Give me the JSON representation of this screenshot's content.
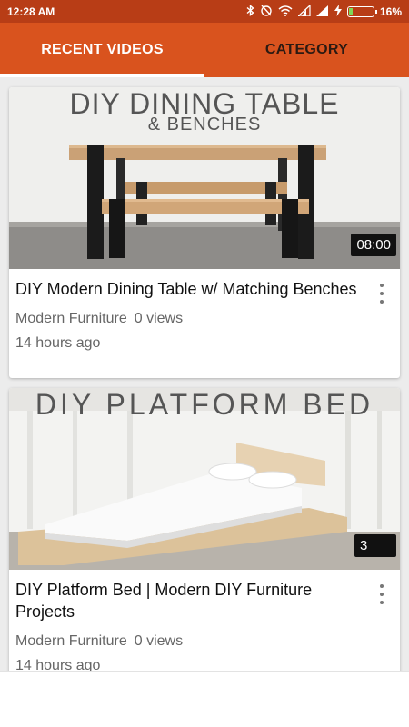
{
  "status_bar": {
    "time": "12:28 AM",
    "battery_percent": "16%",
    "battery_level": 0.16,
    "icons": [
      "bluetooth-icon",
      "alarm-icon",
      "wifi-icon",
      "signal-icon",
      "signal-icon",
      "charging-icon"
    ]
  },
  "tabs": [
    {
      "label": "RECENT VIDEOS",
      "active": true
    },
    {
      "label": "CATEGORY",
      "active": false
    }
  ],
  "videos": [
    {
      "thumbnail_text": "DIY DINING TABLE",
      "thumbnail_subtext": "& BENCHES",
      "duration": "08:00",
      "title": "DIY Modern Dining Table w/ Matching Benches",
      "channel": "Modern Furniture",
      "views": "0 views",
      "time_ago": "14 hours ago"
    },
    {
      "thumbnail_text": "DIY PLATFORM BED",
      "duration": "3",
      "title": "DIY Platform Bed | Modern DIY Furniture Projects",
      "channel": "Modern Furniture",
      "views": "0 views",
      "time_ago": "14 hours ago"
    }
  ],
  "colors": {
    "status_bar": "#b83d16",
    "tab_bar": "#d9531e",
    "active_tab_text": "#ffffff",
    "inactive_tab_text": "#2b1a12"
  }
}
